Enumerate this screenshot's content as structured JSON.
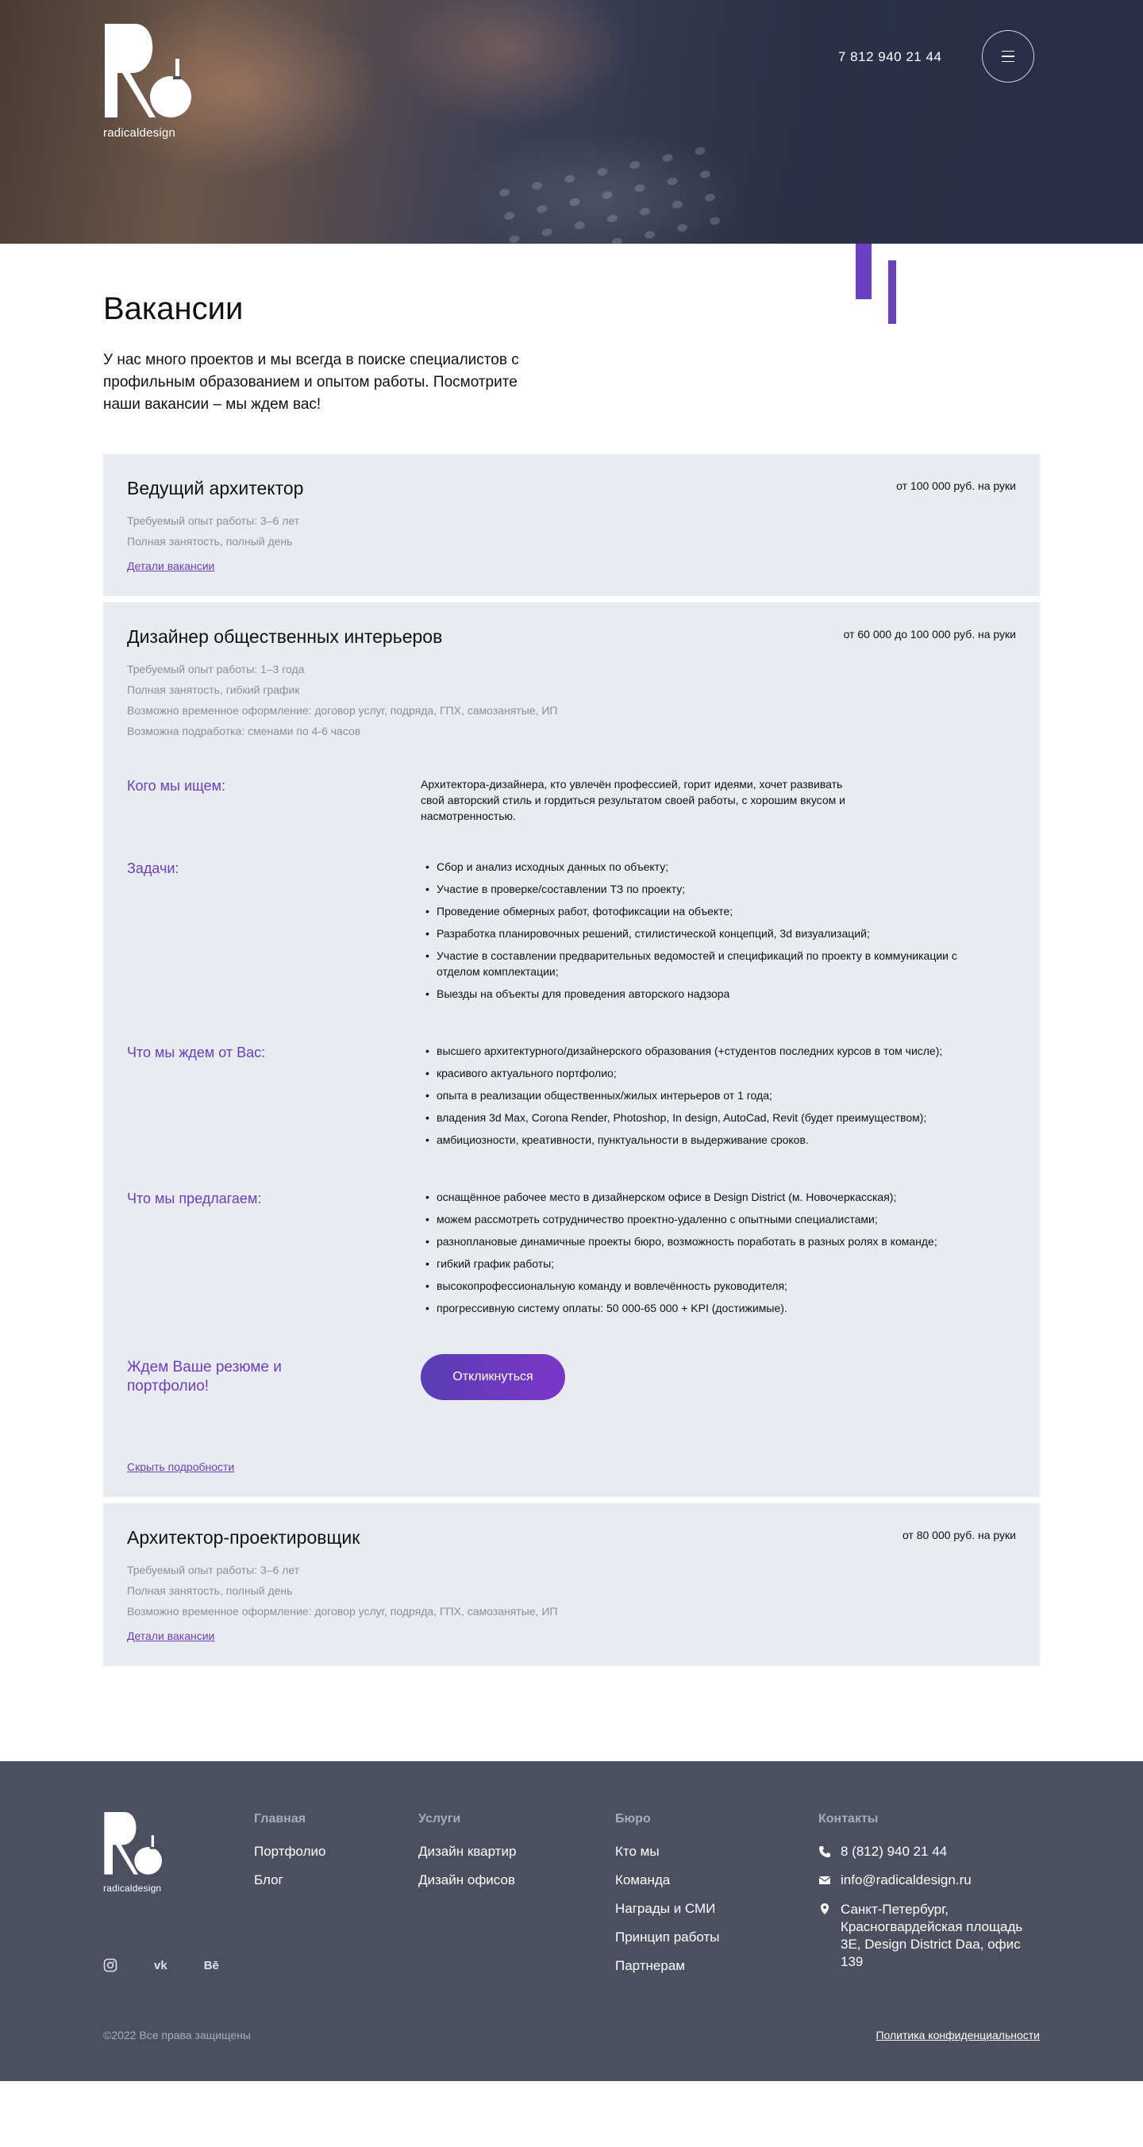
{
  "header": {
    "logo_text": "radicaldesign",
    "phone": "7 812 940 21 44",
    "menu_icon": "hamburger-icon"
  },
  "intro": {
    "title": "Вакансии",
    "text": "У нас много проектов и мы всегда в поиске специалистов с профильным образованием и опытом работы. Посмотрите наши вакансии – мы ждем вас!"
  },
  "vacancies": [
    {
      "title": "Ведущий архитектор",
      "salary": "от 100 000 руб. на руки",
      "meta": [
        "Требуемый опыт работы: 3–6 лет",
        "Полная занятость, полный день"
      ],
      "link": "Детали вакансии"
    },
    {
      "title": "Дизайнер общественных интерьеров",
      "salary": "от 60 000 до 100 000 руб. на руки",
      "meta": [
        "Требуемый опыт работы: 1–3 года",
        "Полная занятость, гибкий график",
        "Возможно временное оформление: договор услуг, подряда, ГПХ, самозанятые, ИП",
        "Возможна подработка: сменами по 4-6 часов"
      ],
      "who": {
        "title": "Кого мы ищем:",
        "text": "Архитектора-дизайнера, кто увлечён профессией, горит идеями, хочет развивать свой авторский стиль и гордиться результатом своей работы, с хорошим вкусом и насмотренностью."
      },
      "tasks": {
        "title": "Задачи:",
        "items": [
          "Сбор и анализ исходных данных по объекту;",
          "Участие в проверке/составлении ТЗ по проекту;",
          "Проведение обмерных работ, фотофиксации на объекте;",
          "Разработка планировочных решений, стилистической концепций, 3d визуализаций;",
          "Участие в составлении предварительных ведомостей и спецификаций по проекту в коммуникации с отделом комплектации;",
          "Выезды на объекты для проведения авторского надзора"
        ]
      },
      "expect": {
        "title": "Что мы ждем от Вас:",
        "items": [
          "высшего архитектурного/дизайнерского образования (+студентов последних курсов в том числе);",
          "красивого актуального портфолио;",
          "опыта в реализации общественных/жилых интерьеров от 1 года;",
          "владения 3d Max, Corona Render, Photoshop, In design, AutoCad, Revit (будет преимуществом);",
          "амбициозности, креативности, пунктуальности в выдерживание сроков."
        ]
      },
      "offer": {
        "title": "Что мы предлагаем:",
        "items": [
          "оснащённое рабочее место в дизайнерском офисе в Design District (м. Новочеркасская);",
          "можем рассмотреть сотрудничество проектно-удаленно с опытными специалистами;",
          "разноплановые динамичные проекты бюро, возможность поработать в разных ролях в команде;",
          "гибкий график работы;",
          "высокопрофессиональную команду и вовлечённость руководителя;",
          "прогрессивную систему оплаты: 50 000-65 000 + KPI (достижимые)."
        ]
      },
      "cta_text": "Ждем Ваше резюме и портфолио!",
      "cta_button": "Откликнуться",
      "hide_link": "Скрыть подробности"
    },
    {
      "title": "Архитектор-проектировщик",
      "salary": "от 80 000 руб. на руки",
      "meta": [
        "Требуемый опыт работы: 3–6 лет",
        "Полная занятость, полный день",
        "Возможно временное оформление: договор услуг, подряда, ГПХ, самозанятые, ИП"
      ],
      "link": "Детали вакансии"
    }
  ],
  "footer": {
    "logo_text": "radicaldesign",
    "columns": [
      {
        "title": "Главная",
        "items": [
          "Портфолио",
          "Блог"
        ]
      },
      {
        "title": "Услуги",
        "items": [
          "Дизайн квартир",
          "Дизайн офисов"
        ]
      },
      {
        "title": "Бюро",
        "items": [
          "Кто мы",
          "Команда",
          "Награды и СМИ",
          "Принцип работы",
          "Партнерам"
        ]
      }
    ],
    "contacts": {
      "title": "Контакты",
      "phone": "8 (812) 940 21 44",
      "email": "info@radicaldesign.ru",
      "address": "Санкт-Петербург, Красногвардейская площадь 3Е, Design District Daa, офис 139"
    },
    "socials": [
      "instagram-icon",
      "vk-icon",
      "behance-icon"
    ],
    "social_labels": {
      "vk": "vk",
      "behance": "Bē"
    },
    "copyright": "©2022 Все права защищены",
    "policy": "Политика конфиденциальности"
  },
  "colors": {
    "accent": "#6a3fc0",
    "card_bg": "#e8ebf0",
    "footer_bg": "#4b4f60"
  }
}
